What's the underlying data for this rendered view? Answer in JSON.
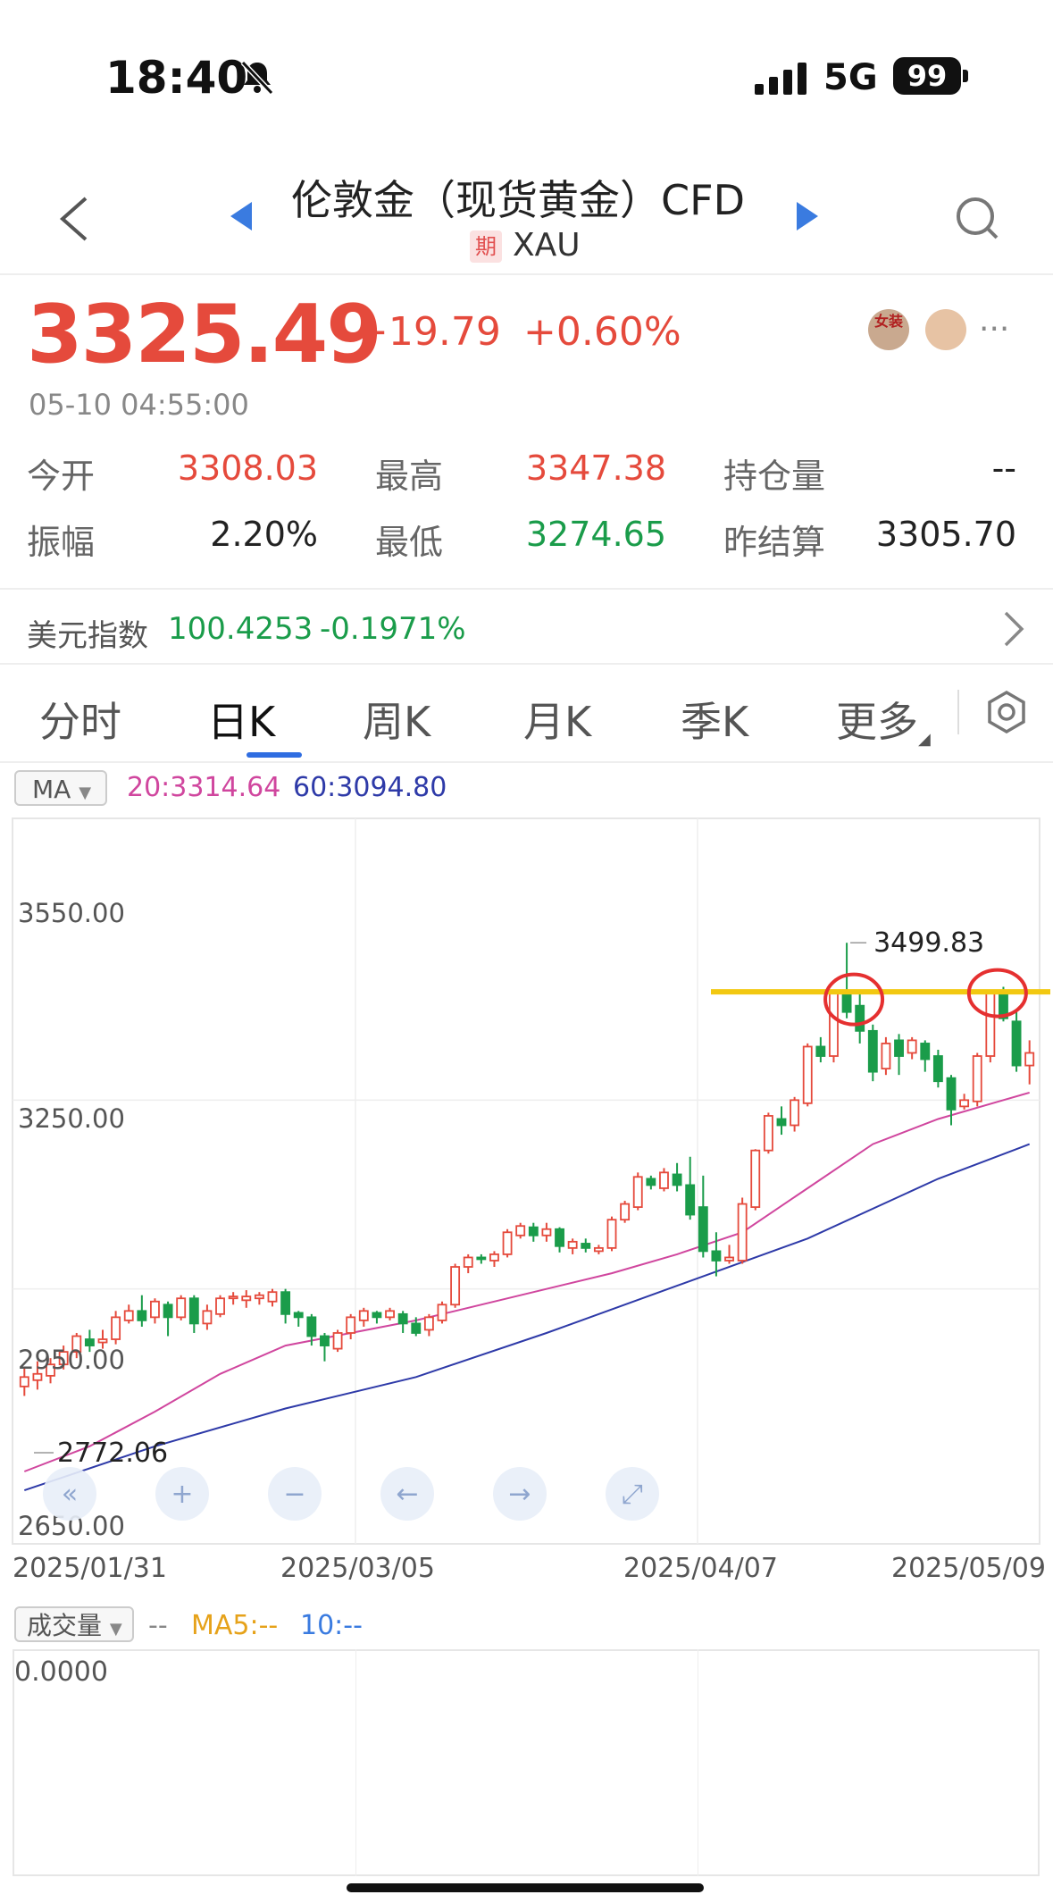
{
  "status": {
    "time": "18:40",
    "network": "5G",
    "battery": "99"
  },
  "header": {
    "title": "伦敦金（现货黄金）CFD",
    "badge": "期",
    "code": "XAU"
  },
  "quote": {
    "price": "3325.49",
    "change": "+19.79",
    "change_pct": "+0.60%",
    "timestamp": "05-10 04:55:00",
    "avatar_text": "女装",
    "stats": [
      {
        "label": "今开",
        "value": "3308.03",
        "color": "red"
      },
      {
        "label": "最高",
        "value": "3347.38",
        "color": "red"
      },
      {
        "label": "持仓量",
        "value": "--",
        "color": "dark"
      },
      {
        "label": "振幅",
        "value": "2.20%",
        "color": "dark"
      },
      {
        "label": "最低",
        "value": "3274.65",
        "color": "green"
      },
      {
        "label": "昨结算",
        "value": "3305.70",
        "color": "dark"
      }
    ]
  },
  "usd_index": {
    "label": "美元指数",
    "value": "100.4253",
    "change": "-0.1971%"
  },
  "tabs": [
    "分时",
    "日K",
    "周K",
    "月K",
    "季K",
    "更多"
  ],
  "active_tab": "日K",
  "ma": {
    "selector": "MA",
    "ma20": "20:3314.64",
    "ma60": "60:3094.80"
  },
  "chart_data": {
    "type": "candlestick",
    "y_ticks": [
      "3550.00",
      "3250.00",
      "2950.00",
      "2650.00"
    ],
    "ylim": [
      2650,
      3550
    ],
    "x_ticks": [
      "2025/01/31",
      "2025/03/05",
      "2025/04/07",
      "2025/05/09"
    ],
    "annotations": {
      "high_label": "3499.83",
      "low_label": "2772.06"
    },
    "colors": {
      "up": "#e54a3c",
      "down": "#1a9c4a",
      "ma20": "#d0469e",
      "ma60": "#2e3aa8",
      "resistance": "#f2c811"
    },
    "candles": [
      [
        2795,
        2810,
        2780,
        2825
      ],
      [
        2805,
        2815,
        2790,
        2835
      ],
      [
        2812,
        2830,
        2800,
        2840
      ],
      [
        2830,
        2850,
        2822,
        2860
      ],
      [
        2850,
        2875,
        2840,
        2880
      ],
      [
        2870,
        2860,
        2850,
        2885
      ],
      [
        2865,
        2870,
        2855,
        2885
      ],
      [
        2870,
        2905,
        2862,
        2915
      ],
      [
        2900,
        2915,
        2895,
        2925
      ],
      [
        2915,
        2900,
        2890,
        2940
      ],
      [
        2905,
        2930,
        2895,
        2935
      ],
      [
        2925,
        2905,
        2875,
        2930
      ],
      [
        2905,
        2935,
        2900,
        2940
      ],
      [
        2935,
        2895,
        2880,
        2940
      ],
      [
        2895,
        2915,
        2885,
        2925
      ],
      [
        2910,
        2935,
        2905,
        2940
      ],
      [
        2935,
        2938,
        2925,
        2945
      ],
      [
        2932,
        2938,
        2920,
        2948
      ],
      [
        2935,
        2940,
        2925,
        2945
      ],
      [
        2930,
        2945,
        2922,
        2950
      ],
      [
        2945,
        2910,
        2895,
        2950
      ],
      [
        2912,
        2905,
        2890,
        2915
      ],
      [
        2905,
        2875,
        2860,
        2910
      ],
      [
        2875,
        2860,
        2835,
        2880
      ],
      [
        2855,
        2880,
        2850,
        2885
      ],
      [
        2880,
        2905,
        2870,
        2910
      ],
      [
        2900,
        2915,
        2890,
        2920
      ],
      [
        2912,
        2905,
        2895,
        2915
      ],
      [
        2905,
        2915,
        2900,
        2920
      ],
      [
        2910,
        2895,
        2880,
        2915
      ],
      [
        2895,
        2880,
        2875,
        2905
      ],
      [
        2885,
        2905,
        2875,
        2910
      ],
      [
        2900,
        2925,
        2895,
        2930
      ],
      [
        2925,
        2985,
        2920,
        2990
      ],
      [
        2985,
        3000,
        2975,
        3005
      ],
      [
        3000,
        2998,
        2990,
        3005
      ],
      [
        2995,
        3005,
        2985,
        3010
      ],
      [
        3005,
        3040,
        3000,
        3045
      ],
      [
        3035,
        3050,
        3030,
        3055
      ],
      [
        3048,
        3035,
        3025,
        3055
      ],
      [
        3035,
        3045,
        3025,
        3055
      ],
      [
        3045,
        3018,
        3008,
        3048
      ],
      [
        3015,
        3025,
        3005,
        3030
      ],
      [
        3022,
        3015,
        3008,
        3030
      ],
      [
        3010,
        3015,
        3005,
        3020
      ],
      [
        3015,
        3060,
        3010,
        3065
      ],
      [
        3060,
        3085,
        3055,
        3090
      ],
      [
        3080,
        3128,
        3075,
        3135
      ],
      [
        3125,
        3115,
        3108,
        3130
      ],
      [
        3110,
        3135,
        3105,
        3142
      ],
      [
        3132,
        3115,
        3105,
        3150
      ],
      [
        3115,
        3068,
        3060,
        3160
      ],
      [
        3080,
        3010,
        3000,
        3130
      ],
      [
        3010,
        2995,
        2970,
        3040
      ],
      [
        2995,
        3000,
        2990,
        3020
      ],
      [
        2995,
        3085,
        2990,
        3095
      ],
      [
        3080,
        3170,
        3075,
        3172
      ],
      [
        3170,
        3225,
        3165,
        3230
      ],
      [
        3220,
        3210,
        3195,
        3240
      ],
      [
        3210,
        3250,
        3200,
        3255
      ],
      [
        3245,
        3335,
        3240,
        3340
      ],
      [
        3335,
        3320,
        3310,
        3350
      ],
      [
        3320,
        3420,
        3310,
        3425
      ],
      [
        3420,
        3390,
        3380,
        3500
      ],
      [
        3400,
        3360,
        3340,
        3425
      ],
      [
        3360,
        3295,
        3280,
        3370
      ],
      [
        3300,
        3340,
        3290,
        3350
      ],
      [
        3345,
        3320,
        3290,
        3355
      ],
      [
        3325,
        3345,
        3315,
        3350
      ],
      [
        3340,
        3315,
        3295,
        3345
      ],
      [
        3320,
        3280,
        3270,
        3330
      ],
      [
        3285,
        3235,
        3210,
        3290
      ],
      [
        3240,
        3250,
        3235,
        3260
      ],
      [
        3248,
        3320,
        3240,
        3325
      ],
      [
        3320,
        3420,
        3310,
        3425
      ],
      [
        3420,
        3380,
        3375,
        3430
      ],
      [
        3375,
        3305,
        3295,
        3390
      ],
      [
        3305,
        3325,
        3275,
        3345
      ]
    ],
    "ma20": [
      [
        0,
        2660
      ],
      [
        5,
        2700
      ],
      [
        10,
        2755
      ],
      [
        15,
        2815
      ],
      [
        20,
        2860
      ],
      [
        25,
        2880
      ],
      [
        30,
        2900
      ],
      [
        35,
        2925
      ],
      [
        40,
        2950
      ],
      [
        45,
        2975
      ],
      [
        50,
        3005
      ],
      [
        55,
        3040
      ],
      [
        60,
        3110
      ],
      [
        65,
        3180
      ],
      [
        70,
        3220
      ],
      [
        75,
        3250
      ],
      [
        77,
        3262
      ]
    ],
    "ma60": [
      [
        0,
        2630
      ],
      [
        10,
        2700
      ],
      [
        20,
        2760
      ],
      [
        30,
        2810
      ],
      [
        40,
        2880
      ],
      [
        50,
        2955
      ],
      [
        60,
        3030
      ],
      [
        70,
        3125
      ],
      [
        77,
        3180
      ]
    ]
  },
  "chart_controls": [
    "«",
    "+",
    "−",
    "←",
    "→",
    "⤢"
  ],
  "volume": {
    "label": "成交量",
    "dash": "--",
    "ma5": "MA5:--",
    "ma10": "10:--",
    "value": "0.0000"
  }
}
